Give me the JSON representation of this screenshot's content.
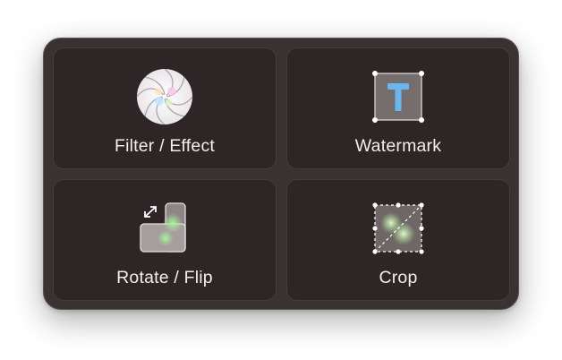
{
  "menu": {
    "items": [
      {
        "label": "Filter / Effect",
        "icon": "aperture-filter-icon"
      },
      {
        "label": "Watermark",
        "icon": "text-watermark-icon"
      },
      {
        "label": "Rotate / Flip",
        "icon": "rotate-flip-icon"
      },
      {
        "label": "Crop",
        "icon": "crop-icon"
      }
    ]
  },
  "colors": {
    "panel": "#3a3131",
    "tile": "#2e2626",
    "label": "#f3eeee",
    "watermark_letter": "#6ab6ee"
  }
}
